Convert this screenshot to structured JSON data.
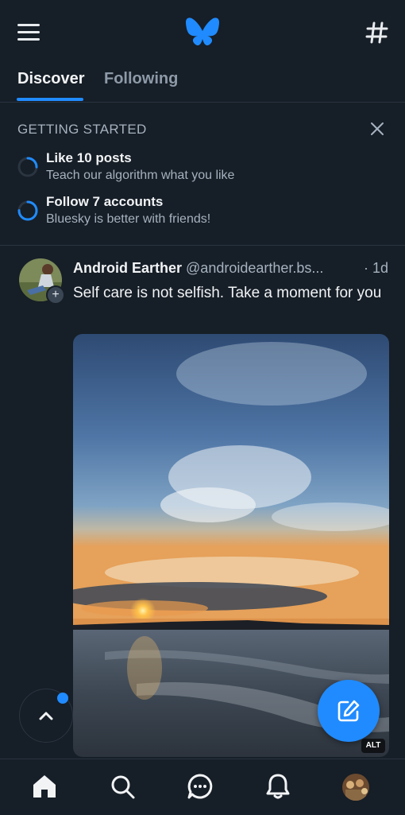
{
  "topbar": {
    "menu_icon": "hamburger-menu-icon",
    "logo_icon": "bluesky-butterfly-icon",
    "feeds_icon": "hash-icon"
  },
  "tabs": [
    {
      "label": "Discover",
      "active": true
    },
    {
      "label": "Following",
      "active": false
    }
  ],
  "getting_started": {
    "title": "GETTING STARTED",
    "close_icon": "close-icon",
    "items": [
      {
        "title": "Like 10 posts",
        "subtitle": "Teach our algorithm what you like",
        "progress": 0.25
      },
      {
        "title": "Follow 7 accounts",
        "subtitle": "Bluesky is better with friends!",
        "progress": 0.75
      }
    ]
  },
  "post": {
    "author": "Android Earther",
    "handle": "@androidearther.bs...",
    "time": "· 1d",
    "text": "Self care is not selfish. Take a moment for you",
    "image_alt_badge": "ALT"
  },
  "bottom_nav": [
    {
      "name": "home-icon"
    },
    {
      "name": "search-icon"
    },
    {
      "name": "chat-icon"
    },
    {
      "name": "bell-icon"
    },
    {
      "name": "profile-avatar"
    }
  ],
  "colors": {
    "background": "#161e27",
    "accent": "#208bfe",
    "muted_text": "#a5b2bf",
    "divider": "#2a3541"
  }
}
